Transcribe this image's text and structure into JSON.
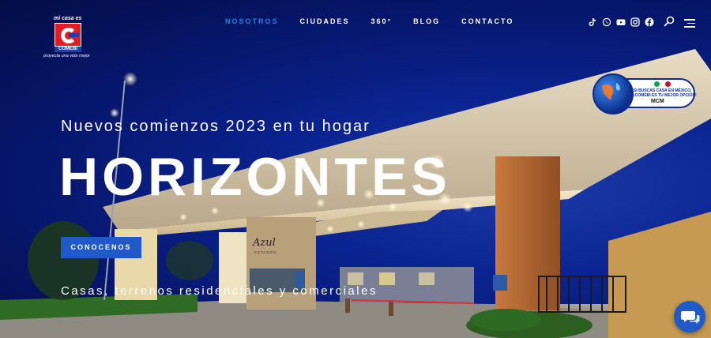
{
  "logo": {
    "top_text": "mi casa es",
    "brand": "COMEBI",
    "tagline": "proyecta una vida mejor"
  },
  "nav": {
    "items": [
      {
        "label": "NOSOTROS",
        "active": true
      },
      {
        "label": "CIUDADES",
        "active": false
      },
      {
        "label": "360°",
        "active": false
      },
      {
        "label": "BLOG",
        "active": false
      },
      {
        "label": "CONTACTO",
        "active": false
      }
    ],
    "active_color": "#2b7fe0"
  },
  "social_icons": [
    "tiktok-icon",
    "whatsapp-icon",
    "youtube-icon",
    "instagram-icon",
    "facebook-icon"
  ],
  "header_icons": [
    "search-icon",
    "menu-icon"
  ],
  "hero": {
    "subtitle": "Nuevos comienzos 2023 en tu hogar",
    "title": "HORIZONTES",
    "cta_label": "CONOCENOS",
    "tagline": "Casas, terrenos residenciales y comerciales",
    "cta_color": "#1f5ac8"
  },
  "sign": {
    "name": "Azul",
    "sub": "ESTADOS"
  },
  "badge": {
    "line1": "SI BUSCAS CASA EN MÉXICO,",
    "line2": "¡COMEBI ES TU MEJOR OPCIÓN!",
    "brand": "MCM"
  },
  "chat_icon": "chat-bubble-icon"
}
